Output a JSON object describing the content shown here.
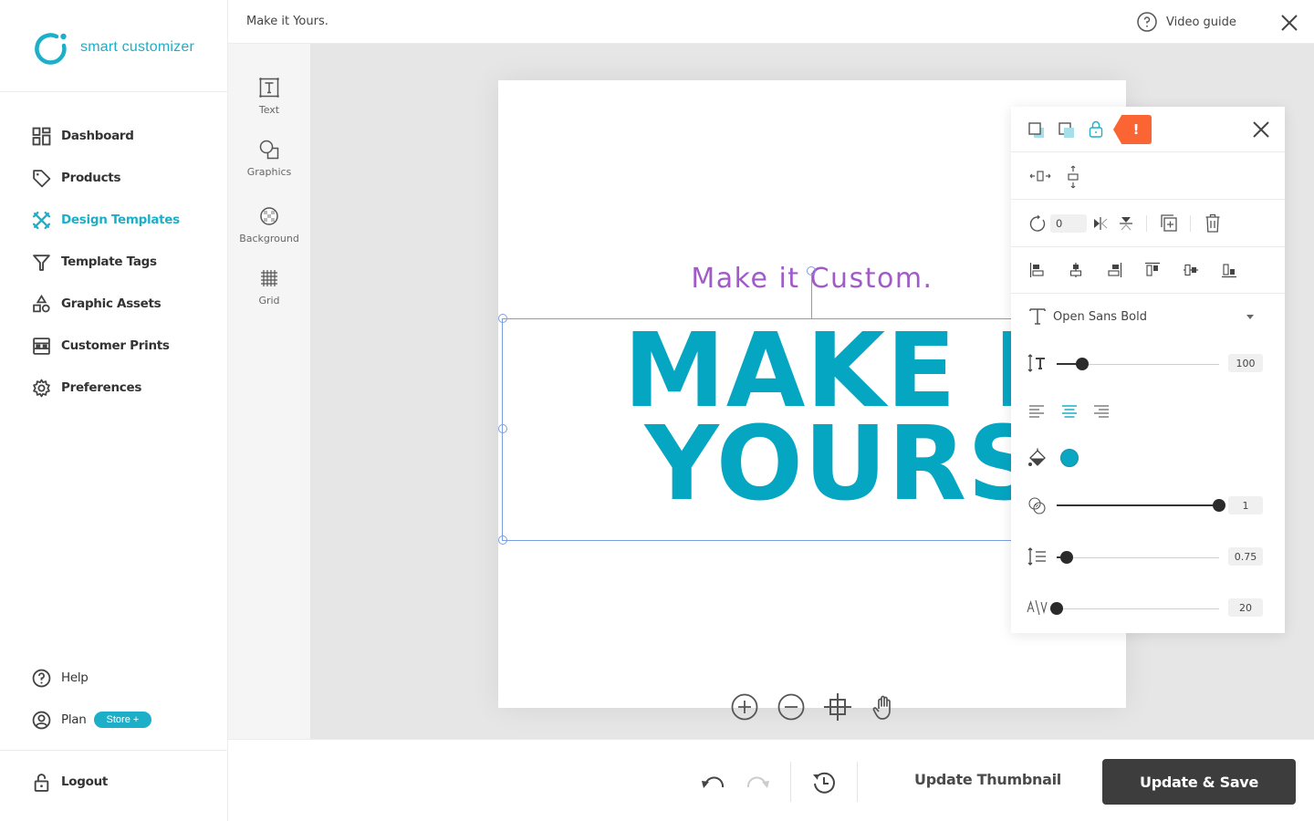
{
  "brand": {
    "name": "smart customizer",
    "color": "#1cafc7"
  },
  "sidebar": {
    "items": [
      {
        "label": "Dashboard",
        "icon": "dashboard-icon",
        "active": false
      },
      {
        "label": "Products",
        "icon": "tag-icon",
        "active": false
      },
      {
        "label": "Design Templates",
        "icon": "design-tools-icon",
        "active": true
      },
      {
        "label": "Template Tags",
        "icon": "filter-icon",
        "active": false
      },
      {
        "label": "Graphic Assets",
        "icon": "shapes-icon",
        "active": false
      },
      {
        "label": "Customer Prints",
        "icon": "prints-icon",
        "active": false
      },
      {
        "label": "Preferences",
        "icon": "gear-icon",
        "active": false
      }
    ],
    "bottom": {
      "help": "Help",
      "plan": "Plan",
      "plan_badge": "Store +",
      "logout": "Logout"
    }
  },
  "topbar": {
    "title": "Make it Yours.",
    "video_guide": "Video guide"
  },
  "tools": [
    {
      "label": "Text",
      "icon": "text-tool-icon"
    },
    {
      "label": "Graphics",
      "icon": "graphics-tool-icon"
    },
    {
      "label": "Background",
      "icon": "background-tool-icon"
    },
    {
      "label": "Grid",
      "icon": "grid-tool-icon"
    }
  ],
  "canvas": {
    "subtitle_text": "Make it Custom.",
    "subtitle_color": "#a05bc8",
    "main_text_line1": "MAKE IT",
    "main_text_line2": "YOURS.",
    "main_text_color": "#05a6c2"
  },
  "properties": {
    "warning_badge": "!",
    "rotation": "0",
    "font": "Open Sans Bold",
    "font_size": {
      "value": "100",
      "fraction": 0.16
    },
    "text_align": "center",
    "fill_color": "#0aa6c2",
    "opacity": {
      "value": "1",
      "fraction": 1.0
    },
    "line_height": {
      "value": "0.75",
      "fraction": 0.06
    },
    "letter_spacing": {
      "value": "20",
      "fraction": 0.0
    }
  },
  "bottombar": {
    "update_thumbnail": "Update Thumbnail",
    "update_save": "Update & Save"
  }
}
